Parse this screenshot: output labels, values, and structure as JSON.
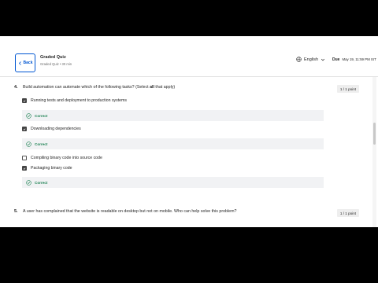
{
  "header": {
    "back_label": "Back",
    "quiz_title": "Graded Quiz",
    "quiz_subtitle": "Graded Quiz • 30 min",
    "language": "English",
    "due_label": "Due",
    "due_date": "May 19, 11:59 PM IST"
  },
  "questions": [
    {
      "number": "4.",
      "text_before": "Build automation can automate which of the following tasks?  (Select ",
      "text_emph": "all",
      "text_after": " that apply)",
      "points": "1 / 1 point",
      "options": [
        {
          "label": "Running tests and deployment to production systems",
          "checked": true,
          "feedback": "Correct"
        },
        {
          "label": "Downloading dependencies",
          "checked": true,
          "feedback": "Correct"
        },
        {
          "label": "Compiling binary code into source code",
          "checked": false
        },
        {
          "label": "Packaging binary code",
          "checked": true,
          "feedback": "Correct"
        }
      ]
    },
    {
      "number": "5.",
      "text": "A user has complained that the website is readable on desktop but not on mobile. Who can help solve this problem?",
      "points": "1 / 1 point"
    }
  ],
  "colors": {
    "accent": "#0056d2",
    "correct": "#1f8354",
    "feedback_bg": "#f1f2f4"
  }
}
